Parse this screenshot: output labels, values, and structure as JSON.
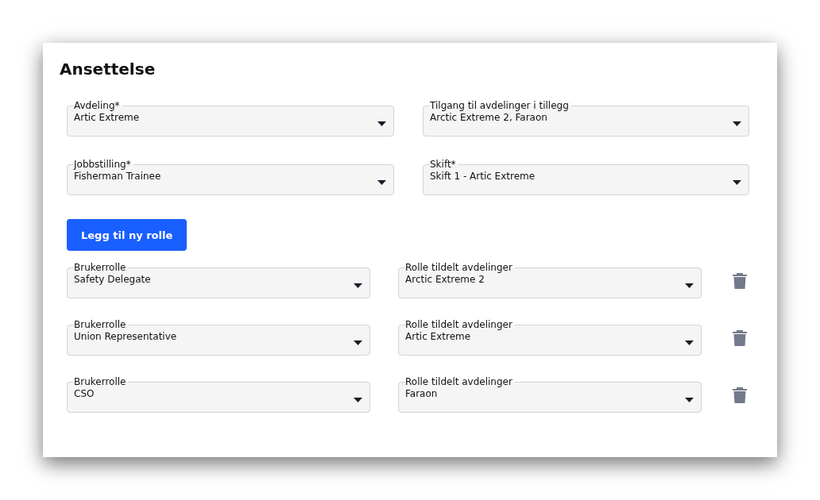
{
  "title": "Ansettelse",
  "fields": [
    {
      "label": "Avdeling*",
      "value": "Artic Extreme"
    },
    {
      "label": "Tilgang til avdelinger i tillegg",
      "value": "Arctic Extreme 2, Faraon"
    },
    {
      "label": "Jobbstilling*",
      "value": "Fisherman Trainee"
    },
    {
      "label": "Skift*",
      "value": "Skift 1 - Artic Extreme"
    }
  ],
  "add_button": "Legg til ny rolle",
  "roles": [
    {
      "role": {
        "label": "Brukerrolle",
        "value": "Safety Delegate"
      },
      "departments": {
        "label": "Rolle tildelt avdelinger",
        "value": "Arctic Extreme 2"
      }
    },
    {
      "role": {
        "label": "Brukerrolle",
        "value": "Union Representative"
      },
      "departments": {
        "label": "Rolle tildelt avdelinger",
        "value": "Artic Extreme"
      }
    },
    {
      "role": {
        "label": "Brukerrolle",
        "value": "CSO"
      },
      "departments": {
        "label": "Rolle tildelt avdelinger",
        "value": "Faraon"
      }
    }
  ]
}
